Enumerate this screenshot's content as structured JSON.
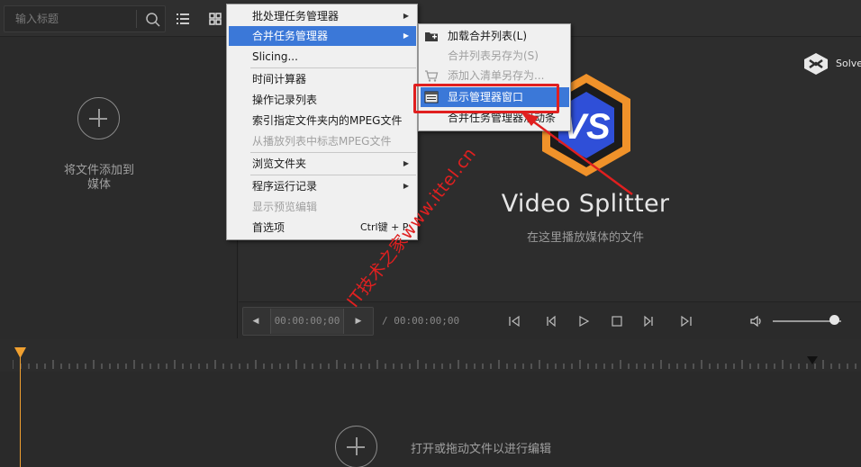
{
  "search": {
    "placeholder": "输入标题"
  },
  "media_panel": {
    "add_text_line1": "将文件添加到",
    "add_text_line2": "媒体"
  },
  "preview": {
    "brand": "Solve",
    "app_title": "Video Splitter",
    "subtitle": "在这里播放媒体的文件"
  },
  "playback": {
    "current_time": "00:00:00;00",
    "total_time": "/ 00:00:00;00",
    "volume_fraction": 0.9
  },
  "timeline": {
    "hint": "打开或拖动文件以进行编辑"
  },
  "menu": {
    "items": [
      {
        "label": "批处理任务管理器",
        "has_submenu": true,
        "disabled": false
      },
      {
        "label": "合并任务管理器",
        "has_submenu": true,
        "highlighted": true
      },
      {
        "label": "Slicing...",
        "disabled": false
      },
      {
        "label": "时间计算器",
        "disabled": false
      },
      {
        "label": "操作记录列表",
        "disabled": false
      },
      {
        "label": "索引指定文件夹内的MPEG文件",
        "disabled": false
      },
      {
        "label": "从播放列表中标志MPEG文件",
        "disabled": true
      },
      {
        "label": "浏览文件夹",
        "has_submenu": true
      },
      {
        "label": "程序运行记录",
        "has_submenu": true
      },
      {
        "label": "显示预览编辑",
        "disabled": true
      },
      {
        "label": "首选项",
        "shortcut": "Ctrl键 + P"
      }
    ]
  },
  "submenu": {
    "items": [
      {
        "label": "加载合并列表(L)",
        "icon": "folder-add-icon",
        "disabled": false
      },
      {
        "label": "合并列表另存为(S)",
        "disabled": true
      },
      {
        "label": "添加入清单另存为...",
        "icon": "cart-icon",
        "disabled": true
      },
      {
        "label": "显示管理器窗口",
        "icon": "window-icon",
        "highlighted": true
      },
      {
        "label": "合并任务管理器滑动条",
        "disabled": false
      }
    ]
  },
  "watermark": "IT技术之家www.ittel.cn",
  "colors": {
    "menu_highlight": "#3b78d8",
    "annotation_red": "#e01f1f",
    "playhead": "#f0a030",
    "vs_orange": "#f0922a",
    "vs_blue": "#2f4fd8"
  }
}
